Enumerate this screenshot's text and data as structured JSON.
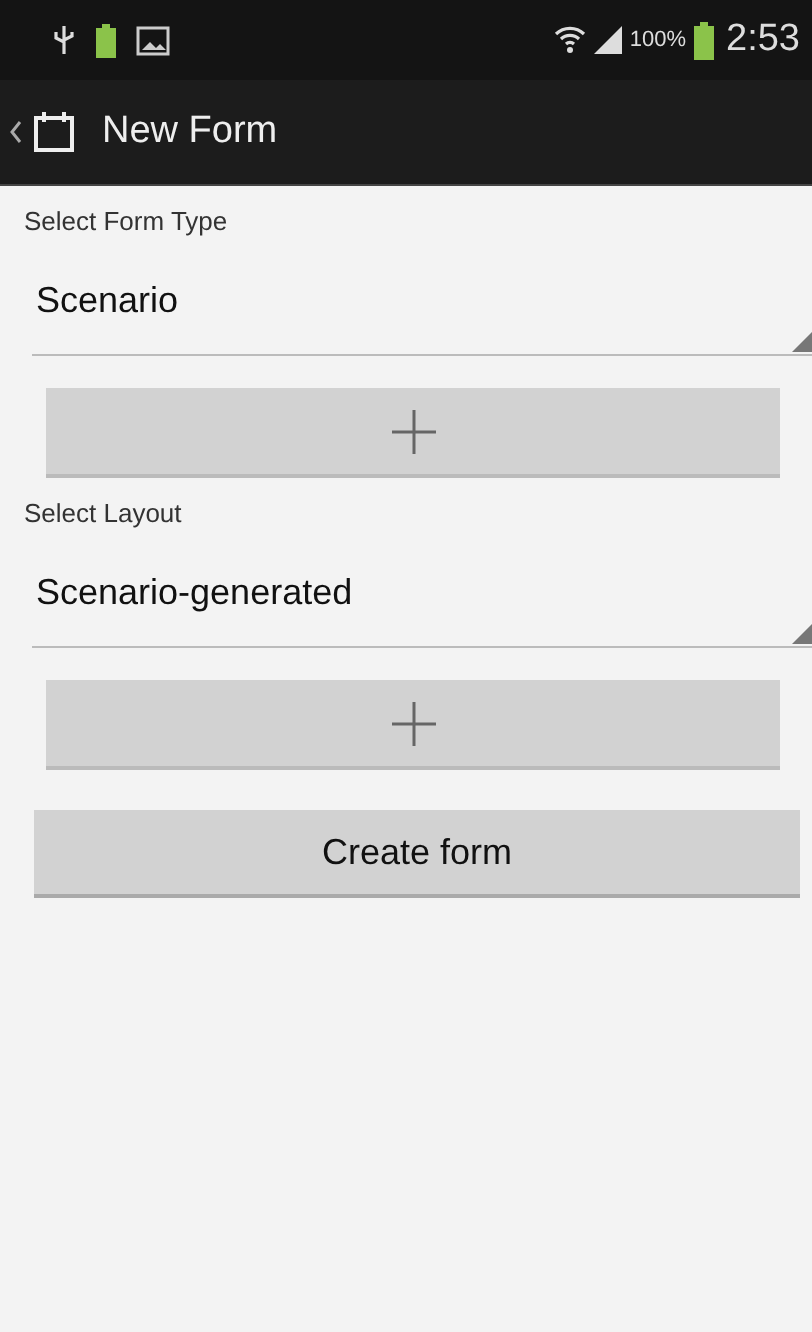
{
  "status_bar": {
    "battery_percent": "100%",
    "time": "2:53"
  },
  "action_bar": {
    "title": "New Form"
  },
  "sections": [
    {
      "label": "Select Form Type",
      "value": "Scenario"
    },
    {
      "label": "Select Layout",
      "value": "Scenario-generated"
    }
  ],
  "create_button": {
    "label": "Create form"
  }
}
